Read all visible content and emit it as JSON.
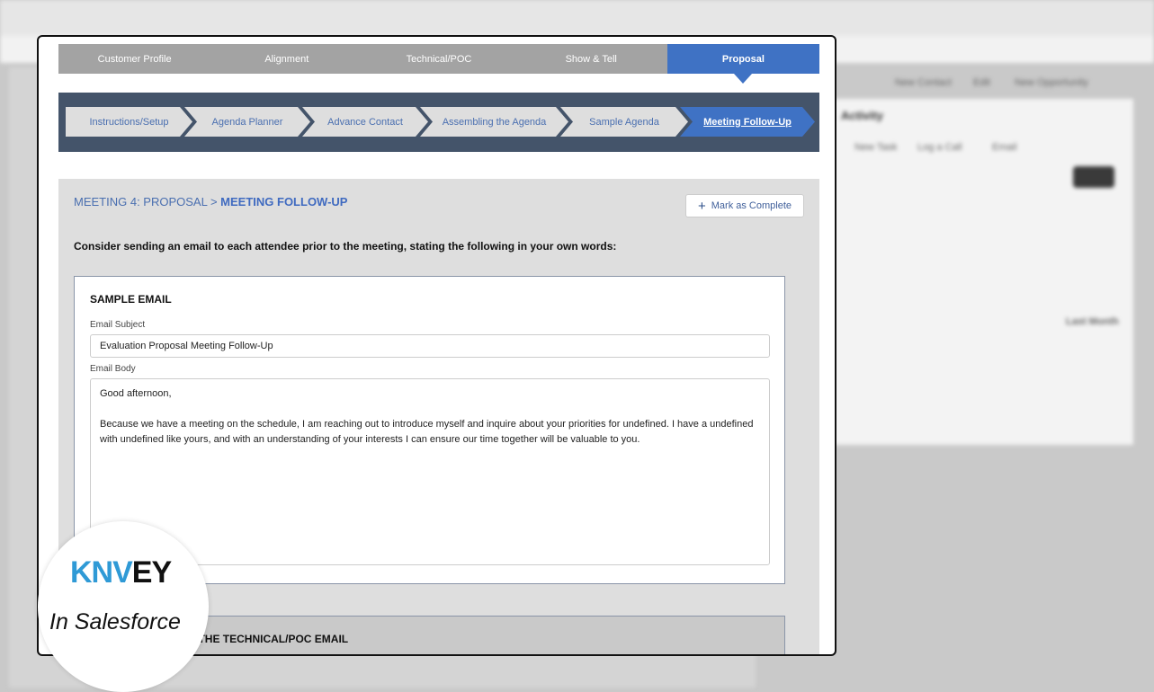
{
  "background": {
    "buttons": [
      "New Contact",
      "Edit",
      "New Opportunity"
    ],
    "activity_title": "Activity",
    "activity_tabs": [
      "New Task",
      "Log a Call",
      "Email"
    ],
    "section": "Last Month"
  },
  "tabs": [
    {
      "label": "Customer Profile"
    },
    {
      "label": "Alignment"
    },
    {
      "label": "Technical/POC"
    },
    {
      "label": "Show & Tell"
    },
    {
      "label": "Proposal",
      "active": true
    }
  ],
  "steps": [
    {
      "label": "Instructions/Setup"
    },
    {
      "label": "Agenda Planner"
    },
    {
      "label": "Advance Contact"
    },
    {
      "label": "Assembling the Agenda"
    },
    {
      "label": "Sample Agenda"
    },
    {
      "label": "Meeting Follow-Up",
      "active": true
    }
  ],
  "breadcrumb": {
    "parent": "MEETING 4: PROPOSAL >",
    "current": "MEETING FOLLOW-UP"
  },
  "mark_complete": "Mark as Complete",
  "intro": "Consider sending an email to each attendee prior to the meeting, stating the following in your own words:",
  "sample_email": {
    "title": "SAMPLE EMAIL",
    "subject_label": "Email Subject",
    "subject": "Evaluation Proposal Meeting Follow-Up",
    "body_label": "Email Body",
    "body_greeting": "Good afternoon,",
    "body_text": "Because we have a meeting on the schedule, I am reaching out to introduce myself and inquire about your priorities for undefined.  I have a undefined with undefined like yours, and with an understanding of your interests I can ensure our time together will be valuable to you."
  },
  "next_section": "STEPS TO SENDING THE TECHNICAL/POC EMAIL",
  "logo": {
    "brand": "KNVEY",
    "tagline": "In Salesforce"
  },
  "colors": {
    "accent": "#3f72c4",
    "steps_bg": "#44546a",
    "tab_bg": "#a3a3a3"
  }
}
